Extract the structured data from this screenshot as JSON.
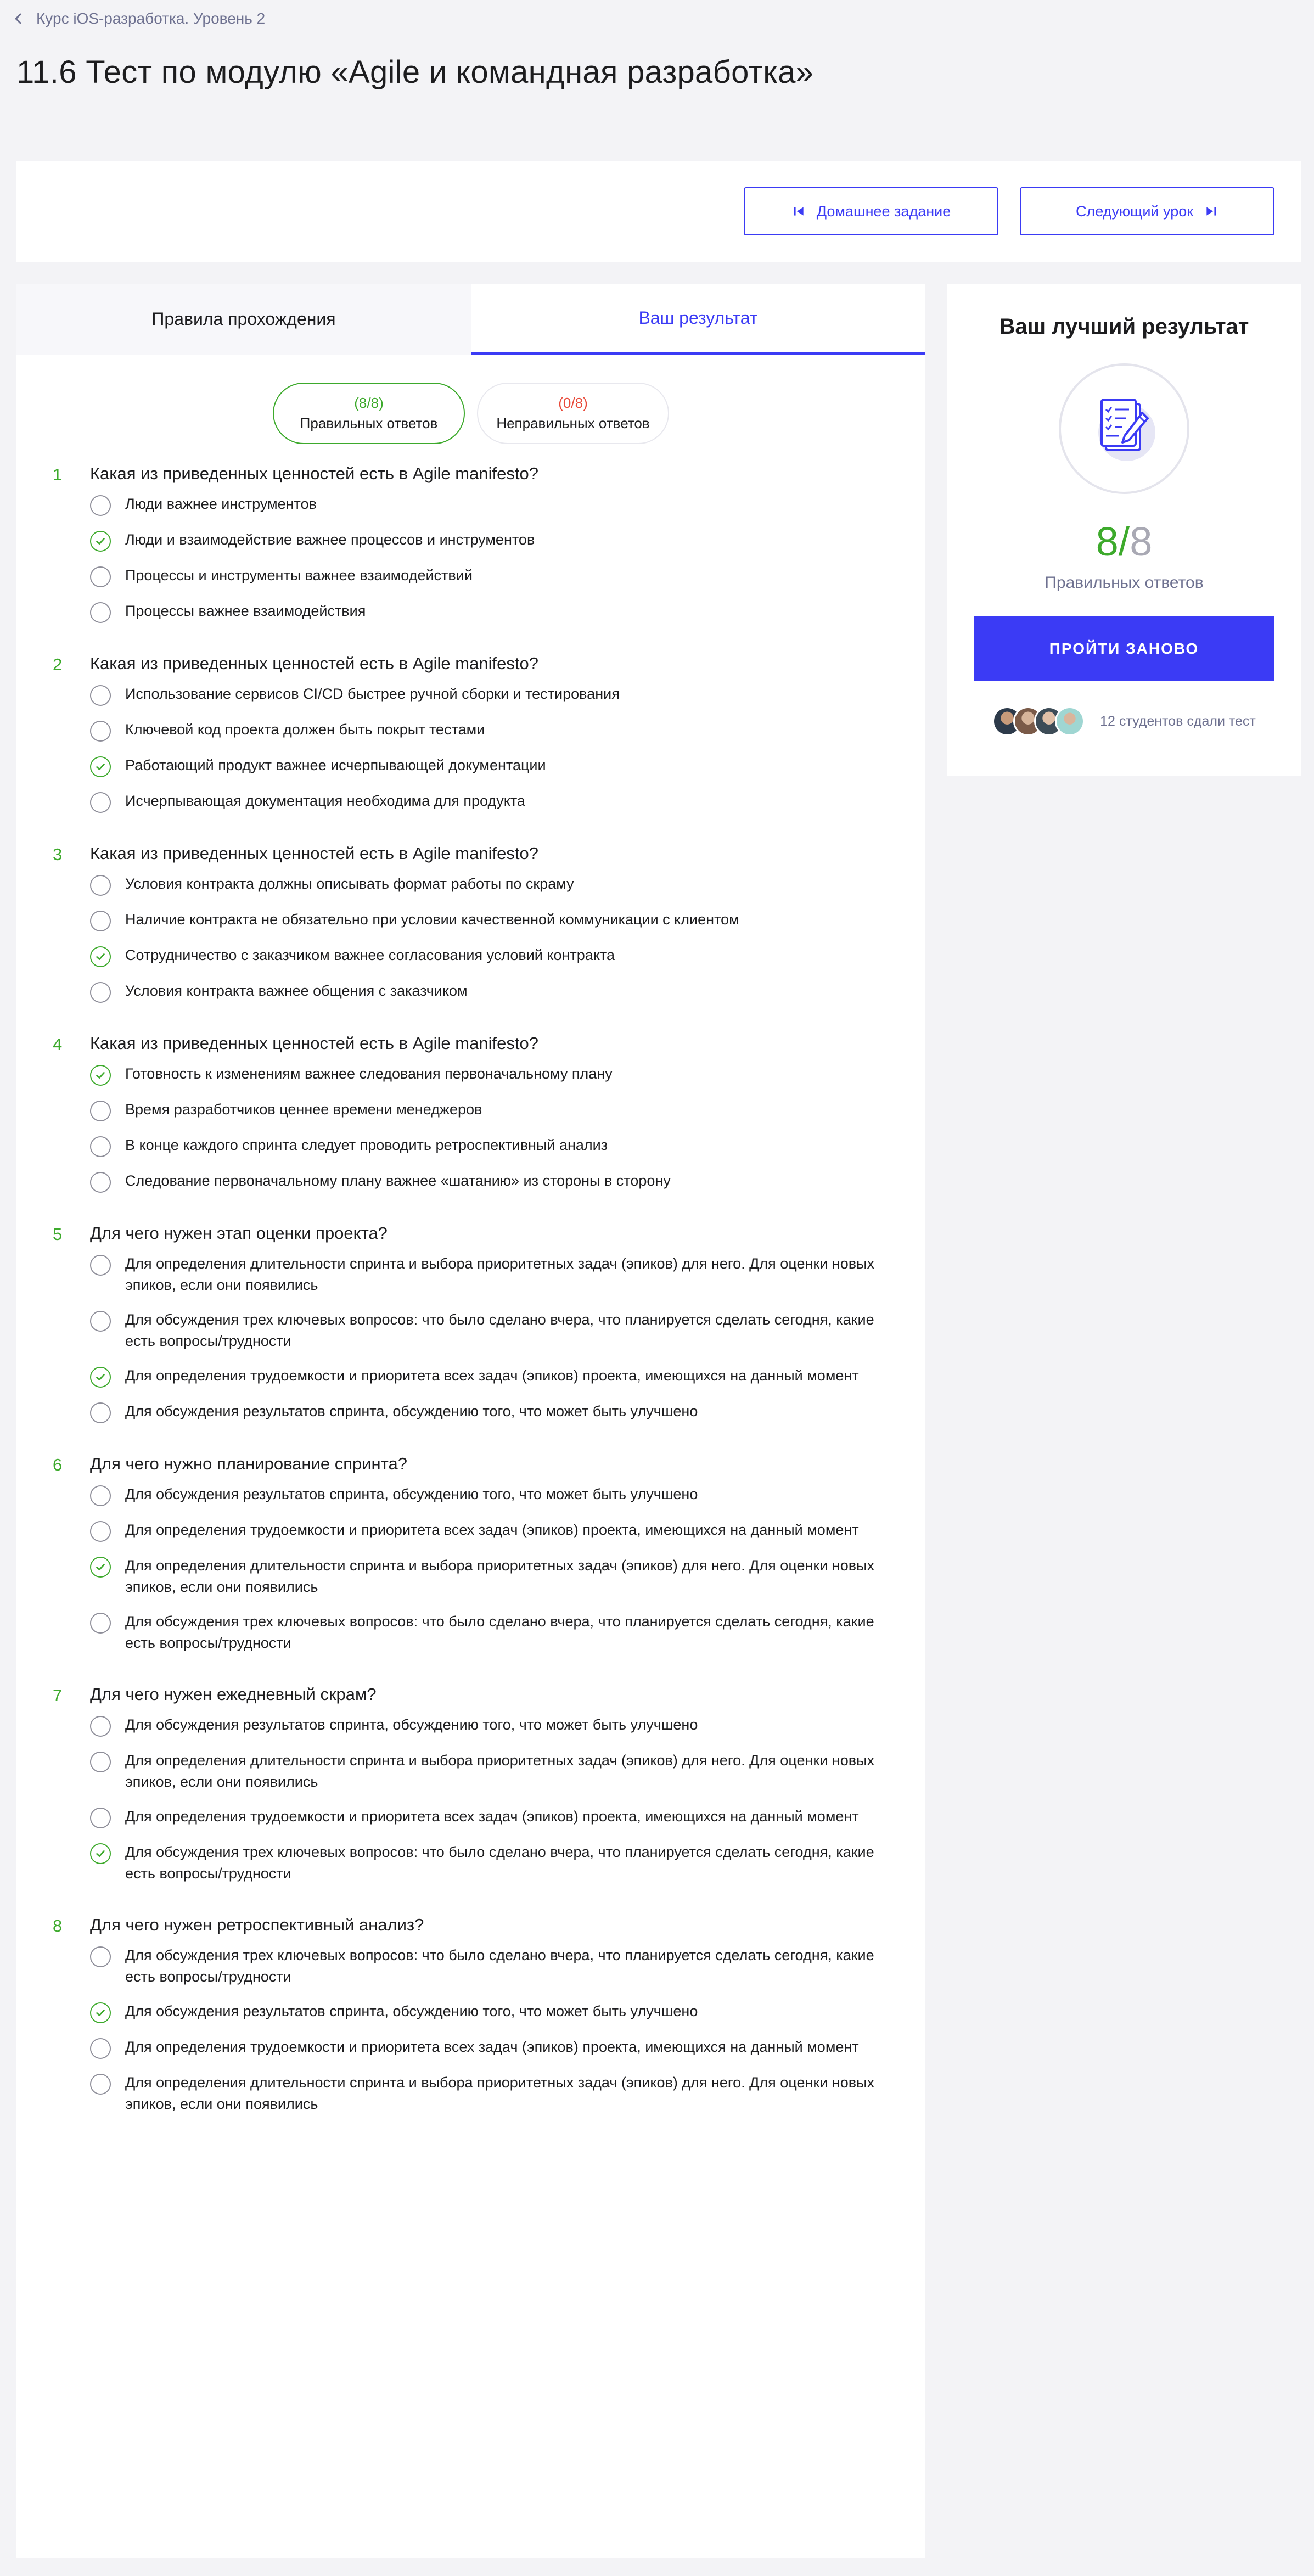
{
  "breadcrumb": {
    "label": "Курс iOS-разработка. Уровень 2"
  },
  "page": {
    "title": "11.6 Тест по модулю «Agile и командная разработка»"
  },
  "nav": {
    "prev_label": "Домашнее задание",
    "next_label": "Следующий урок"
  },
  "tabs": [
    {
      "label": "Правила прохождения",
      "active": false
    },
    {
      "label": "Ваш результат",
      "active": true
    }
  ],
  "summary": {
    "correct_count": "(8/8)",
    "correct_label": "Правильных ответов",
    "wrong_count": "(0/8)",
    "wrong_label": "Неправильных ответов"
  },
  "questions": [
    {
      "num": "1",
      "text": "Какая из приведенных ценностей есть в Agile manifesto?",
      "answers": [
        {
          "text": "Люди важнее инструментов",
          "checked": false
        },
        {
          "text": "Люди и взаимодействие важнее процессов и инструментов",
          "checked": true
        },
        {
          "text": "Процессы и инструменты важнее взаимодействий",
          "checked": false
        },
        {
          "text": "Процессы важнее взаимодействия",
          "checked": false
        }
      ]
    },
    {
      "num": "2",
      "text": "Какая из приведенных ценностей есть в Agile manifesto?",
      "answers": [
        {
          "text": "Использование сервисов CI/CD быстрее ручной сборки и тестирования",
          "checked": false
        },
        {
          "text": "Ключевой код проекта должен быть покрыт тестами",
          "checked": false
        },
        {
          "text": "Работающий продукт важнее исчерпывающей документации",
          "checked": true
        },
        {
          "text": "Исчерпывающая документация необходима для продукта",
          "checked": false
        }
      ]
    },
    {
      "num": "3",
      "text": "Какая из приведенных ценностей есть в Agile manifesto?",
      "answers": [
        {
          "text": "Условия контракта должны описывать формат работы по скраму",
          "checked": false
        },
        {
          "text": "Наличие контракта не обязательно при условии качественной коммуникации с клиентом",
          "checked": false
        },
        {
          "text": "Сотрудничество с заказчиком важнее согласования условий контракта",
          "checked": true
        },
        {
          "text": "Условия контракта важнее общения с заказчиком",
          "checked": false
        }
      ]
    },
    {
      "num": "4",
      "text": "Какая из приведенных ценностей есть в Agile manifesto?",
      "answers": [
        {
          "text": "Готовность к изменениям важнее следования первоначальному плану",
          "checked": true
        },
        {
          "text": "Время разработчиков ценнее времени менеджеров",
          "checked": false
        },
        {
          "text": "В конце каждого спринта следует проводить ретроспективный анализ",
          "checked": false
        },
        {
          "text": "Следование первоначальному плану важнее «шатанию» из стороны в сторону",
          "checked": false
        }
      ]
    },
    {
      "num": "5",
      "text": "Для чего нужен этап оценки проекта?",
      "answers": [
        {
          "text": "Для определения длительности спринта и выбора приоритетных задач (эпиков) для него. Для оценки новых эпиков, если они появились",
          "checked": false
        },
        {
          "text": "Для обсуждения трех ключевых вопросов: что было сделано вчера, что планируется сделать сегодня, какие есть вопросы/трудности",
          "checked": false
        },
        {
          "text": "Для определения трудоемкости и приоритета всех задач (эпиков) проекта, имеющихся на данный момент",
          "checked": true
        },
        {
          "text": "Для обсуждения результатов спринта, обсуждению того, что может быть улучшено",
          "checked": false
        }
      ]
    },
    {
      "num": "6",
      "text": "Для чего нужно планирование спринта?",
      "answers": [
        {
          "text": "Для обсуждения результатов спринта, обсуждению того, что может быть улучшено",
          "checked": false
        },
        {
          "text": "Для определения трудоемкости и приоритета всех задач (эпиков) проекта, имеющихся на данный момент",
          "checked": false
        },
        {
          "text": "Для определения длительности спринта и выбора приоритетных задач (эпиков) для него. Для оценки новых эпиков, если они появились",
          "checked": true
        },
        {
          "text": "Для обсуждения трех ключевых вопросов: что было сделано вчера, что планируется сделать сегодня, какие есть вопросы/трудности",
          "checked": false
        }
      ]
    },
    {
      "num": "7",
      "text": "Для чего нужен ежедневный скрам?",
      "answers": [
        {
          "text": "Для обсуждения результатов спринта, обсуждению того, что может быть улучшено",
          "checked": false
        },
        {
          "text": "Для определения длительности спринта и выбора приоритетных задач (эпиков) для него. Для оценки новых эпиков, если они появились",
          "checked": false
        },
        {
          "text": "Для определения трудоемкости и приоритета всех задач (эпиков) проекта, имеющихся на данный момент",
          "checked": false
        },
        {
          "text": "Для обсуждения трех ключевых вопросов: что было сделано вчера, что планируется сделать сегодня, какие есть вопросы/трудности",
          "checked": true
        }
      ]
    },
    {
      "num": "8",
      "text": "Для чего нужен ретроспективный анализ?",
      "answers": [
        {
          "text": "Для обсуждения трех ключевых вопросов: что было сделано вчера, что планируется сделать сегодня, какие есть вопросы/трудности",
          "checked": false
        },
        {
          "text": "Для обсуждения результатов спринта, обсуждению того, что может быть улучшено",
          "checked": true
        },
        {
          "text": "Для определения трудоемкости и приоритета всех задач (эпиков) проекта, имеющихся на данный момент",
          "checked": false
        },
        {
          "text": "Для определения длительности спринта и выбора приоритетных задач (эпиков) для него. Для оценки новых эпиков, если они появились",
          "checked": false
        }
      ]
    }
  ],
  "result": {
    "title": "Ваш лучший результат",
    "icon": "test-document-icon",
    "score_got": "8/",
    "score_total": "8",
    "label": "Правильных ответов",
    "retry_label": "ПРОЙТИ ЗАНОВО",
    "students_text": "12 студентов сдали тест"
  },
  "colors": {
    "accent": "#3b3bf5",
    "success": "#3daa2c",
    "error": "#e84a3a",
    "muted": "#6e7190",
    "background": "#f3f3f6"
  }
}
